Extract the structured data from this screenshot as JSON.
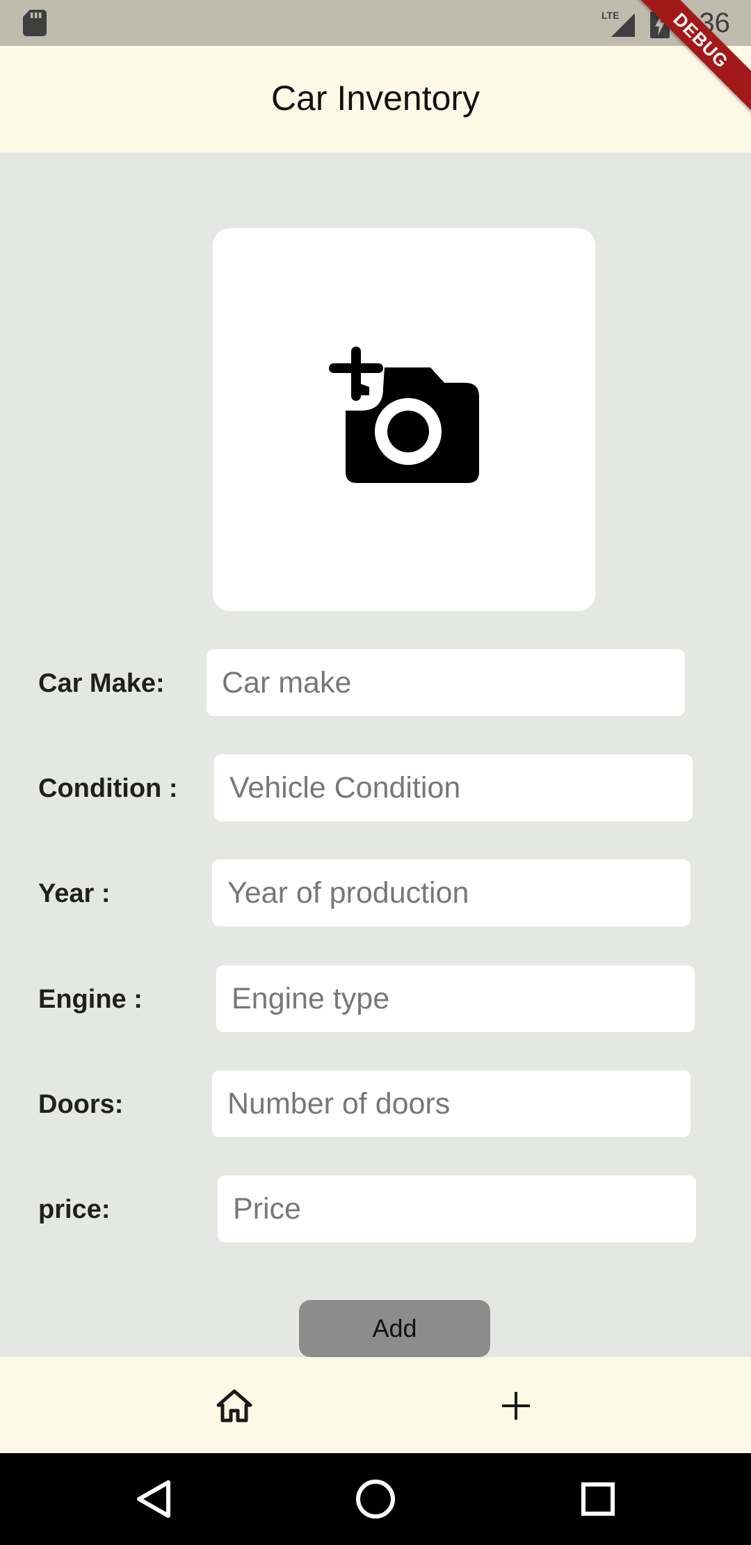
{
  "status_bar": {
    "time": "2:36",
    "network": "LTE",
    "icons": [
      "sd-card-icon",
      "signal-icon",
      "battery-charging-icon"
    ]
  },
  "debug_banner": "DEBUG",
  "app_bar": {
    "title": "Car Inventory"
  },
  "image_picker": {
    "icon": "add-a-photo-icon"
  },
  "form": {
    "car_make": {
      "label": "Car Make:",
      "placeholder": "Car make",
      "value": ""
    },
    "condition": {
      "label": "Condition :",
      "placeholder": "Vehicle Condition",
      "value": ""
    },
    "year": {
      "label": "Year :",
      "placeholder": "Year of production",
      "value": ""
    },
    "engine": {
      "label": "Engine :",
      "placeholder": "Engine type",
      "value": ""
    },
    "doors": {
      "label": "Doors:",
      "placeholder": "Number of doors",
      "value": ""
    },
    "price": {
      "label": "price:",
      "placeholder": "Price",
      "value": ""
    }
  },
  "add_button": {
    "label": "Add"
  },
  "bottom_nav": {
    "items": [
      {
        "icon": "home-icon"
      },
      {
        "icon": "add-icon"
      }
    ]
  },
  "system_nav": {
    "icons": [
      "back-icon",
      "home-circle-icon",
      "recents-icon"
    ]
  },
  "colors": {
    "background": "#E4E7E2",
    "app_bar": "#FEF8E6",
    "status_bar": "#BFBCAE",
    "button": "#8C8C8C",
    "debug_banner": "#A31919"
  }
}
